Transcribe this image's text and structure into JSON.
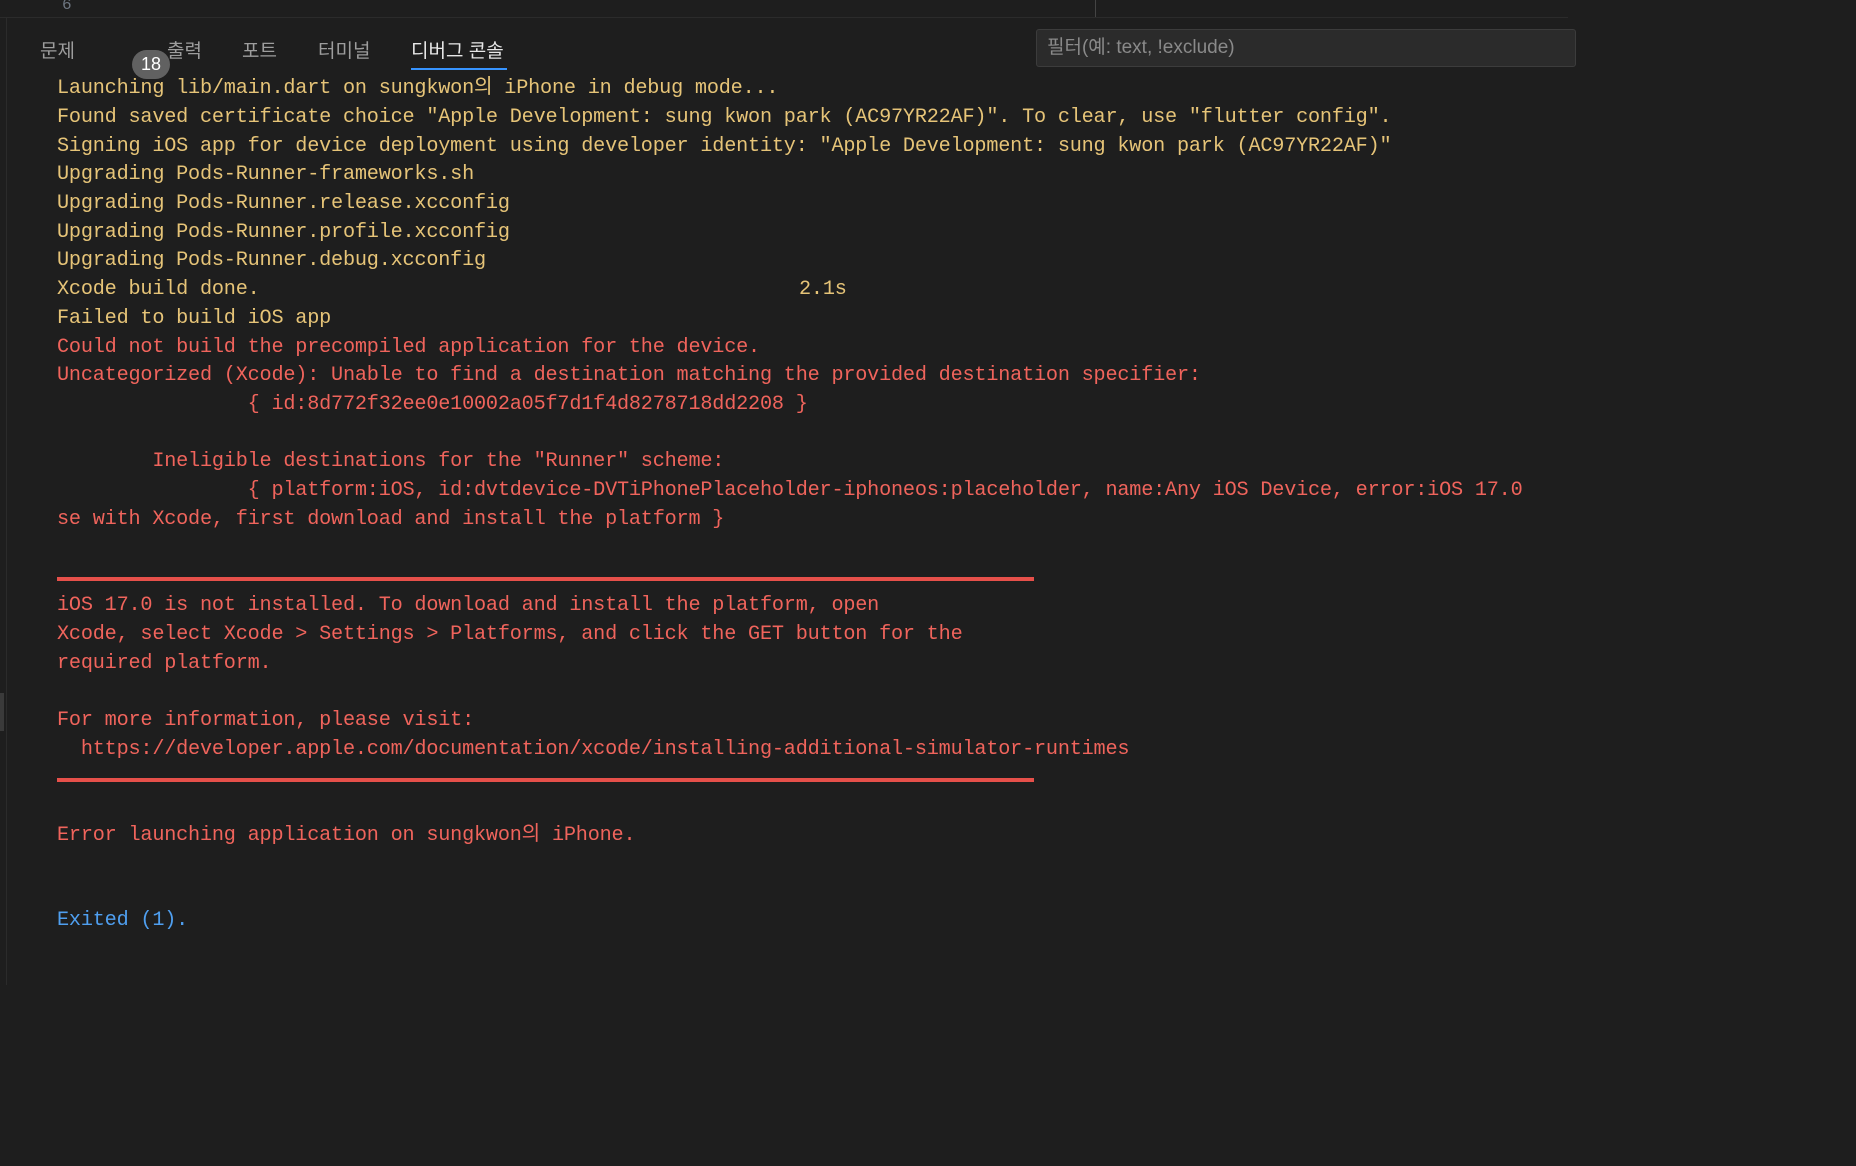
{
  "editor": {
    "line_number": "6"
  },
  "panel": {
    "tabs": {
      "problems": {
        "label": "문제",
        "badge": "18"
      },
      "output": {
        "label": "출력"
      },
      "ports": {
        "label": "포트"
      },
      "terminal": {
        "label": "터미널"
      },
      "debug_console": {
        "label": "디버그 콘솔"
      }
    },
    "active_tab": "debug_console",
    "filter": {
      "placeholder": "필터(예: text, !exclude)",
      "value": ""
    }
  },
  "console": {
    "lines": {
      "l1": "Launching lib/main.dart on sungkwon의 iPhone in debug mode...",
      "l2": "Found saved certificate choice \"Apple Development: sung kwon park (AC97YR22AF)\". To clear, use \"flutter config\".",
      "l3": "Signing iOS app for device deployment using developer identity: \"Apple Development: sung kwon park (AC97YR22AF)\"",
      "l4": "Upgrading Pods-Runner-frameworks.sh",
      "l5": "Upgrading Pods-Runner.release.xcconfig",
      "l6": "Upgrading Pods-Runner.profile.xcconfig",
      "l7": "Upgrading Pods-Runner.debug.xcconfig",
      "l8": "Xcode build done.",
      "l8_time": "2.1s",
      "l9": "Failed to build iOS app",
      "l10": "Could not build the precompiled application for the device.",
      "l11": "Uncategorized (Xcode): Unable to find a destination matching the provided destination specifier:",
      "l12": "                { id:8d772f32ee0e10002a05f7d1f4d8278718dd2208 }",
      "l13": "        Ineligible destinations for the \"Runner\" scheme:",
      "l14": "                { platform:iOS, id:dvtdevice-DVTiPhonePlaceholder-iphoneos:placeholder, name:Any iOS Device, error:iOS 17.0",
      "l15": "se with Xcode, first download and install the platform }",
      "l16": "iOS 17.0 is not installed. To download and install the platform, open",
      "l17": "Xcode, select Xcode > Settings > Platforms, and click the GET button for the",
      "l18": "required platform.",
      "l19": "For more information, please visit:",
      "l20": "  https://developer.apple.com/documentation/xcode/installing-additional-simulator-runtimes",
      "l21": "Error launching application on sungkwon의 iPhone.",
      "l22": "Exited (1)."
    }
  },
  "colors": {
    "info_text": "#e6c478",
    "error_text": "#f0645c",
    "exit_text": "#4f9ff0",
    "accent": "#3794ff",
    "background": "#1e1e1e"
  }
}
